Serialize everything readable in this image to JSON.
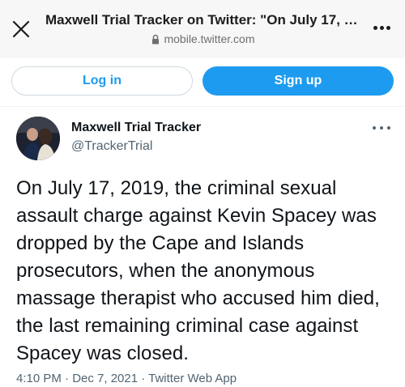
{
  "browser": {
    "title": "Maxwell Trial Tracker on Twitter: \"On July 17, 2...",
    "url": "mobile.twitter.com",
    "icons": {
      "close": "close-icon",
      "lock": "lock-icon",
      "more": "more-icon"
    }
  },
  "auth": {
    "login_label": "Log in",
    "signup_label": "Sign up",
    "accent": "#1d9bf0"
  },
  "tweet": {
    "author_name": "Maxwell Trial Tracker",
    "author_handle": "@TrackerTrial",
    "text": "On July 17, 2019, the criminal sexual assault charge against Kevin Spacey was dropped by the Cape and Islands prosecutors, when the anonymous massage therapist who accused him died, the last remaining criminal case against Spacey was closed.",
    "meta": "4:10 PM · Dec 7, 2021 · Twitter Web App"
  }
}
